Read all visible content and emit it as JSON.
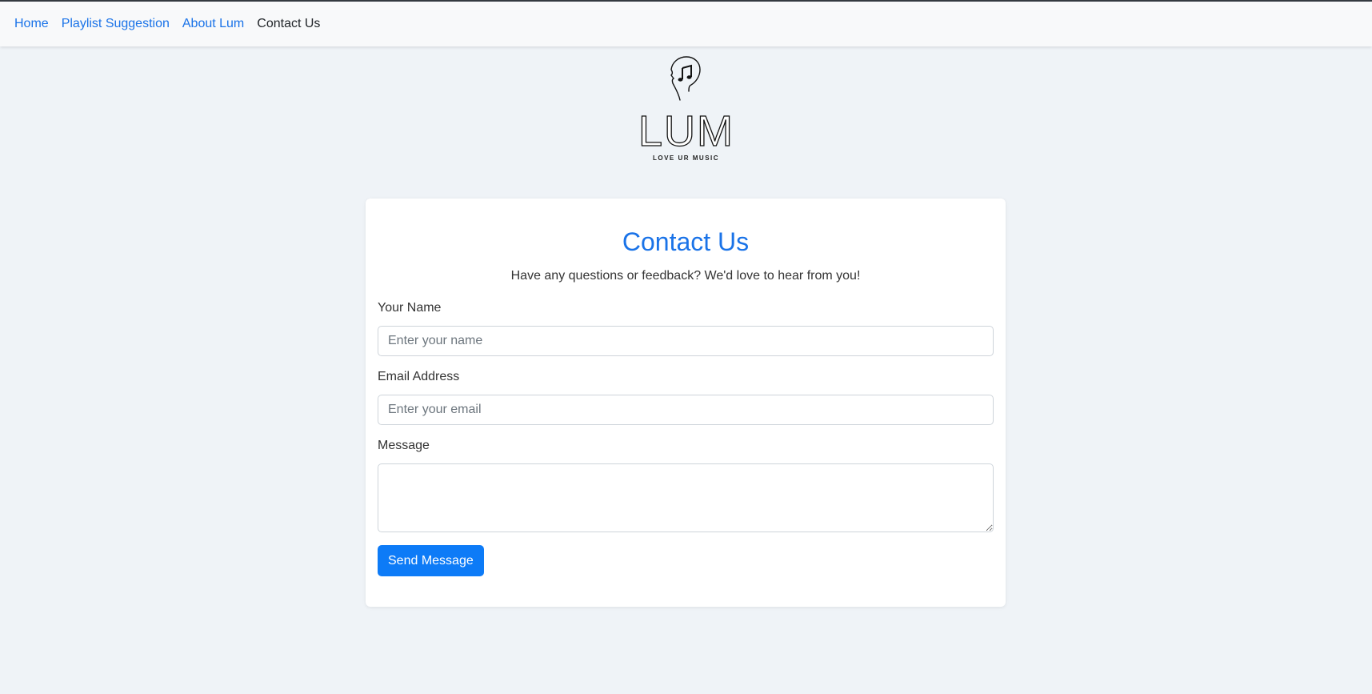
{
  "nav": {
    "items": [
      {
        "label": "Home",
        "active": false
      },
      {
        "label": "Playlist Suggestion",
        "active": false
      },
      {
        "label": "About Lum",
        "active": false
      },
      {
        "label": "Contact Us",
        "active": true
      }
    ]
  },
  "logo": {
    "wordmark": "LUM",
    "tagline": "LOVE UR MUSIC",
    "icon": "head-with-music-note-icon"
  },
  "contact": {
    "title": "Contact Us",
    "subtitle": "Have any questions or feedback? We'd love to hear from you!",
    "name_label": "Your Name",
    "name_placeholder": "Enter your name",
    "email_label": "Email Address",
    "email_placeholder": "Enter your email",
    "message_label": "Message",
    "message_value": "",
    "submit_label": "Send Message"
  },
  "colors": {
    "accent": "#1a73e8",
    "button": "#0d7bf7",
    "background": "#eff3f7"
  }
}
